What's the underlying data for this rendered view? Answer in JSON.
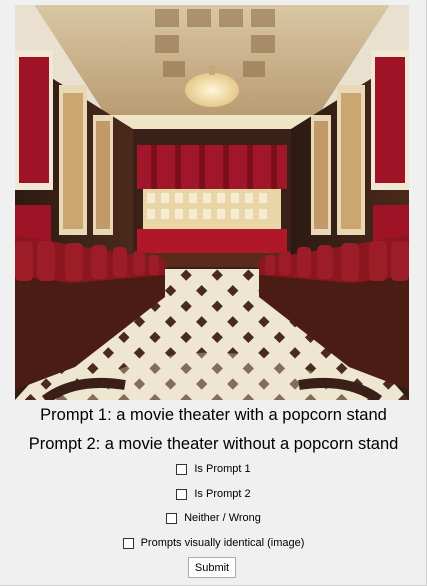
{
  "image": {
    "alt": "a movie theater with a popcorn stand"
  },
  "prompts": {
    "prompt1": "Prompt 1: a movie theater with a popcorn stand",
    "prompt2": "Prompt 2: a movie theater without a popcorn stand"
  },
  "options": [
    {
      "label": "Is Prompt 1",
      "checked": false
    },
    {
      "label": "Is Prompt 2",
      "checked": false
    },
    {
      "label": "Neither / Wrong",
      "checked": false
    },
    {
      "label": "Prompts visually identical (image)",
      "checked": false
    }
  ],
  "submit_label": "Submit",
  "colors": {
    "background": "#f0f0f0",
    "seat_red": "#8b1620",
    "wall_red": "#a11628",
    "ceiling_gold": "#c9a878"
  }
}
